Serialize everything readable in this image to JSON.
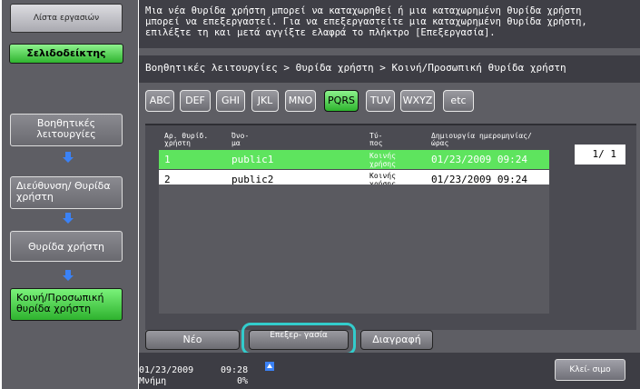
{
  "message": {
    "line1": "Μια νέα θυρίδα χρήστη μπορεί να καταχωρηθεί ή μια καταχωρημένη θυρίδα χρήστη",
    "line2": "μπορεί να επεξεργαστεί. Για να επεξεργαστείτε μια καταχωρημένη θυρίδα χρήστη,",
    "line3": "επιλέξτε τη και μετά αγγίξτε ελαφρά το πλήκτρο [Επεξεργασία]."
  },
  "left": {
    "list_label": "Λίστα εργασιών",
    "bookmark_label": "Σελιδοδείκτης",
    "func_label": "Βοηθητικές λειτουργίες",
    "addr_label": "Διεύθυνση/ Θυρίδα χρήστη",
    "box_label": "Θυρίδα χρήστη",
    "public_label": "Κοινή/Προσωπική θυρίδα χρήστη"
  },
  "breadcrumb": "Βοηθητικές λειτουργίες > Θυρίδα χρήστη > Κοινή/Προσωπική θυρίδα χρήστη",
  "tabs": [
    "ABC",
    "DEF",
    "GHI",
    "JKL",
    "MNO",
    "PQRS",
    "TUV",
    "WXYZ",
    "etc"
  ],
  "active_tab": "PQRS",
  "table": {
    "headers": {
      "num": "Αρ. θυρίδ. χρήστη",
      "name": "Όνο- μα",
      "type": "Τύ- πος",
      "date": "Δημιουργία ημερομηνίας/ώρας"
    },
    "rows": [
      {
        "num": "1",
        "name": "public1",
        "type": "Κοινής χρήσης",
        "date": "01/23/2009 09:24"
      },
      {
        "num": "2",
        "name": "public2",
        "type": "Κοινής χρήσης",
        "date": "01/23/2009 09:24"
      }
    ],
    "selected_row": 0
  },
  "pager": "1/ 1",
  "actions": {
    "new": "Νέο",
    "edit": "Επεξερ- γασία",
    "delete": "Διαγραφή"
  },
  "status": {
    "date": "01/23/2009",
    "time": "09:28",
    "memory_label": "Μνήμη",
    "memory_value": "0%"
  },
  "close_label": "Κλεί- σιμο",
  "colors": {
    "accent_green": "#2eb42e",
    "highlight": "#33cccc",
    "panel": "#5e5e64"
  }
}
